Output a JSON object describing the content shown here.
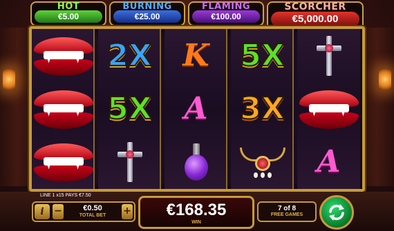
{
  "jackpots": {
    "hot": {
      "title": "HOT",
      "value": "€5.00"
    },
    "burning": {
      "title": "BURNING",
      "value": "€25.00"
    },
    "flaming": {
      "title": "FLAMING",
      "value": "€100.00"
    },
    "scorcher": {
      "title": "SCORCHER",
      "value": "€5,000.00"
    }
  },
  "reels": [
    [
      "lips",
      "lips",
      "lips"
    ],
    [
      "2X",
      "5X",
      "cross"
    ],
    [
      "K",
      "A",
      "bottle"
    ],
    [
      "5X",
      "3X",
      "necklace"
    ],
    [
      "cross",
      "lips",
      "A"
    ]
  ],
  "symbols": {
    "mult_2x": "2X",
    "mult_5x": "5X",
    "mult_3x": "3X",
    "letter_k": "K",
    "letter_a": "A"
  },
  "bottom": {
    "line_info": "LINE 1 x15 PAYS €7.50",
    "info_label": "i",
    "minus_label": "−",
    "plus_label": "+",
    "total_bet_value": "€0.50",
    "total_bet_label": "TOTAL BET",
    "win_value": "€168.35",
    "win_label": "WIN",
    "free_games_count": "7 of 8",
    "free_games_label": "FREE GAMES"
  },
  "icons": {
    "spin": "spin-arrows-icon"
  }
}
